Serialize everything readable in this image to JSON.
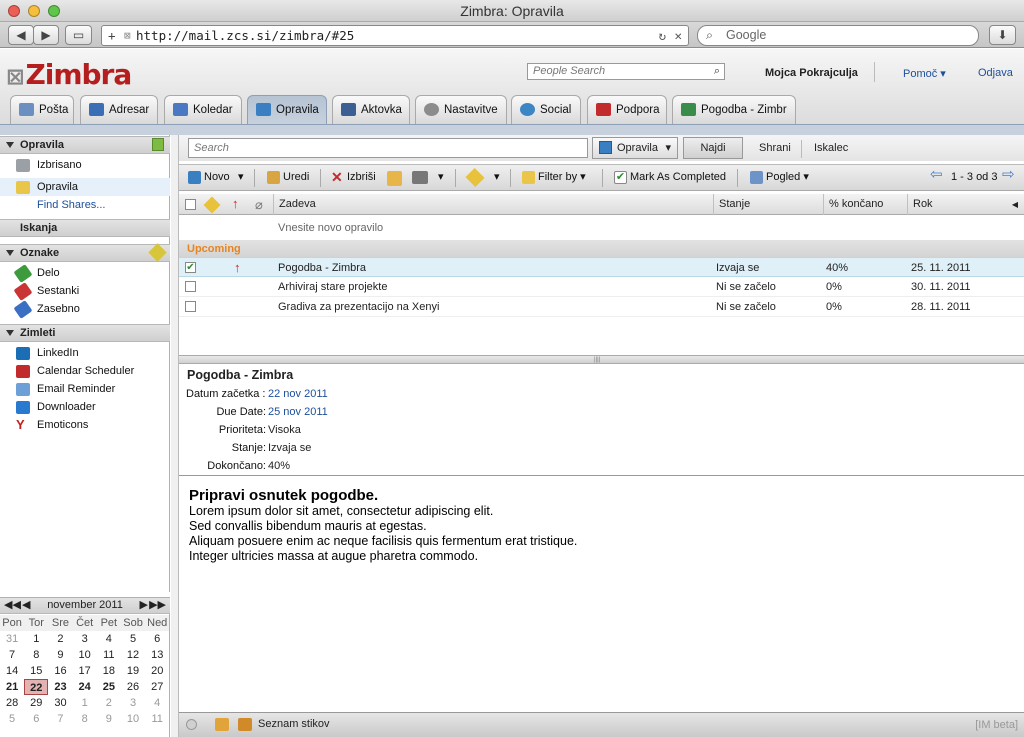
{
  "window": {
    "title": "Zimbra: Opravila"
  },
  "browser": {
    "url": "http://mail.zcs.si/zimbra/#25",
    "search_placeholder": "Google"
  },
  "header": {
    "logo": "Zimbra",
    "people_search_placeholder": "People Search",
    "user": "Mojca Pokrajculja",
    "help": "Pomoč",
    "logout": "Odjava"
  },
  "tabs": [
    {
      "label": "Pošta",
      "color": "#6a8fc0"
    },
    {
      "label": "Adresar",
      "color": "#3b6fb5"
    },
    {
      "label": "Koledar",
      "color": "#4a78c2"
    },
    {
      "label": "Opravila",
      "color": "#3a7fc2"
    },
    {
      "label": "Aktovka",
      "color": "#3c5f93"
    },
    {
      "label": "Nastavitve",
      "color": "#8c8c8c"
    },
    {
      "label": "Social",
      "color": "#3d86c6"
    },
    {
      "label": "Podpora",
      "color": "#c22b2b"
    },
    {
      "label": "Pogodba - Zimbr",
      "color": "#3a8c4a"
    }
  ],
  "sidebar": {
    "tasks_header": "Opravila",
    "tasks": [
      {
        "label": "Izbrisano",
        "icon": "trash-icon"
      },
      {
        "label": "Opravila",
        "icon": "task-list-icon"
      }
    ],
    "find_shares": "Find Shares...",
    "searches_header": "Iskanja",
    "tags_header": "Oznake",
    "tags": [
      {
        "label": "Delo",
        "color": "#3d9a3d"
      },
      {
        "label": "Sestanki",
        "color": "#c93434"
      },
      {
        "label": "Zasebno",
        "color": "#3a6fc4"
      }
    ],
    "zimlets_header": "Zimleti",
    "zimlets": [
      {
        "label": "LinkedIn",
        "icon": "linkedin-icon"
      },
      {
        "label": "Calendar Scheduler",
        "icon": "zimbra-icon"
      },
      {
        "label": "Email Reminder",
        "icon": "email-reminder-icon"
      },
      {
        "label": "Downloader",
        "icon": "download-icon"
      },
      {
        "label": "Emoticons",
        "icon": "yahoo-icon"
      }
    ]
  },
  "calendar": {
    "month": "november 2011",
    "days_of_week": [
      "Pon",
      "Tor",
      "Sre",
      "Čet",
      "Pet",
      "Sob",
      "Ned"
    ],
    "weeks": [
      [
        "31",
        "1",
        "2",
        "3",
        "4",
        "5",
        "6"
      ],
      [
        "7",
        "8",
        "9",
        "10",
        "11",
        "12",
        "13"
      ],
      [
        "14",
        "15",
        "16",
        "17",
        "18",
        "19",
        "20"
      ],
      [
        "21",
        "22",
        "23",
        "24",
        "25",
        "26",
        "27"
      ],
      [
        "28",
        "29",
        "30",
        "1",
        "2",
        "3",
        "4"
      ],
      [
        "5",
        "6",
        "7",
        "8",
        "9",
        "10",
        "11"
      ]
    ],
    "today": "22"
  },
  "search": {
    "placeholder": "Search",
    "type": "Opravila",
    "find": "Najdi",
    "save": "Shrani",
    "finder": "Iskalec"
  },
  "actions": {
    "new": "Novo",
    "edit": "Uredi",
    "delete": "Izbriši",
    "filter": "Filter by",
    "mark_completed": "Mark As Completed",
    "view": "Pogled",
    "paging": "1 - 3 od 3"
  },
  "columns": {
    "subject": "Zadeva",
    "status": "Stanje",
    "percent": "% končano",
    "due": "Rok"
  },
  "new_task_hint": "Vnesite novo opravilo",
  "group_label": "Upcoming",
  "tasks": [
    {
      "subject": "Pogodba - Zimbra",
      "status": "Izvaja se",
      "percent": "40%",
      "due": "25. 11. 2011",
      "selected": true,
      "high_priority": true
    },
    {
      "subject": "Arhiviraj stare projekte",
      "status": "Ni se začelo",
      "percent": "0%",
      "due": "30. 11. 2011",
      "selected": false,
      "high_priority": false
    },
    {
      "subject": "Gradiva za prezentacijo na Xenyi",
      "status": "Ni se začelo",
      "percent": "0%",
      "due": "28. 11. 2011",
      "selected": false,
      "high_priority": false
    }
  ],
  "detail": {
    "title": "Pogodba - Zimbra",
    "start_label": "Datum začetka :",
    "start": "22 nov 2011",
    "due_label": "Due Date:",
    "due": "25 nov 2011",
    "priority_label": "Prioriteta:",
    "priority": "Visoka",
    "status_label": "Stanje:",
    "status": "Izvaja se",
    "completed_label": "Dokončano:",
    "completed": "40%",
    "body_heading": "Pripravi osnutek pogodbe.",
    "body_lines": [
      "Lorem ipsum dolor sit amet, consectetur adipiscing elit.",
      "Sed convallis bibendum mauris at egestas.",
      "Aliquam posuere enim ac neque facilisis quis fermentum erat tristique.",
      "Integer ultricies massa at augue pharetra commodo."
    ]
  },
  "footer": {
    "contacts": "Seznam stikov",
    "im": "[IM beta]"
  }
}
